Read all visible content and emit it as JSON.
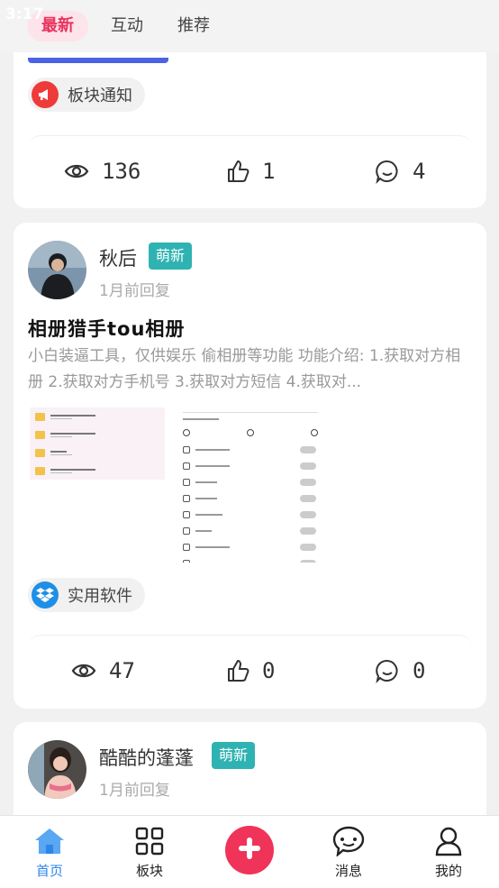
{
  "status": {
    "time": "3:17"
  },
  "tabs": [
    {
      "label": "最新"
    },
    {
      "label": "互动"
    },
    {
      "label": "推荐"
    }
  ],
  "card1": {
    "tag": {
      "label": "板块通知",
      "icon": "megaphone-icon",
      "color": "#ef3a3a"
    },
    "stats": {
      "views": "136",
      "likes": "1",
      "comments": "4"
    }
  },
  "card2": {
    "author": "秋后",
    "badge": "萌新",
    "time": "1月前回复",
    "title": "相册猎手tou相册",
    "body": "小白装逼工具，仅供娱乐 偷相册等功能 功能介绍: 1.获取对方相册 2.获取对方手机号 3.获取对方短信 4.获取对...",
    "tag": {
      "label": "实用软件",
      "icon": "dropbox-icon",
      "color": "#1f8fe5"
    },
    "stats": {
      "views": "47",
      "likes": "0",
      "comments": "0"
    }
  },
  "card3": {
    "author": "酷酷的蓬蓬",
    "badge": "萌新",
    "time": "1月前回复"
  },
  "nav": {
    "home": "首页",
    "boards": "板块",
    "messages": "消息",
    "mine": "我的"
  },
  "colors": {
    "accent": "#e9345f",
    "nav_active": "#2e86e8",
    "badge": "#2fb3b2",
    "fab": "#f03359"
  }
}
